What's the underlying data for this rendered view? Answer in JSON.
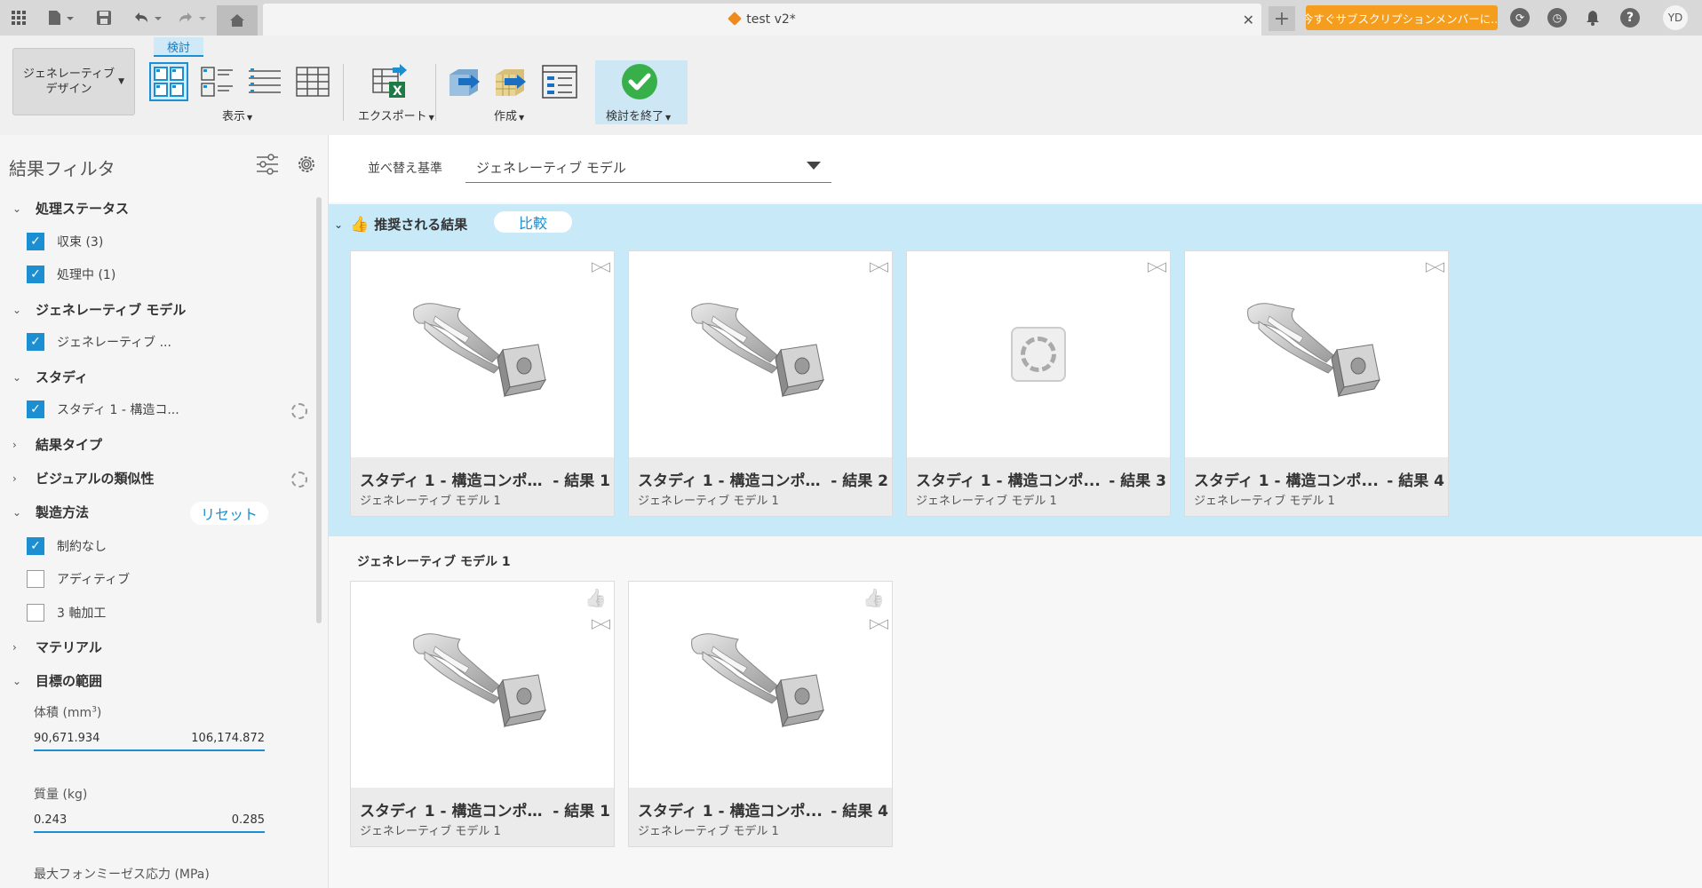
{
  "titlebar": {
    "doc_title": "test v2*",
    "subscribe_label": "今すぐサブスクリプションメンバーに...",
    "user_initials": "YD"
  },
  "ribbon": {
    "generative_design_label": "ジェネレーティブ\nデザイン",
    "active_tab": "検討",
    "display_label": "表示",
    "export_label": "エクスポート",
    "create_label": "作成",
    "finish_label": "検討を終了"
  },
  "left_panel": {
    "title": "結果フィルタ",
    "sections": {
      "status": "処理ステータス",
      "status_converged": "収束 (3)",
      "status_processing": "処理中 (1)",
      "model": "ジェネレーティブ モデル",
      "model_item": "ジェネレーティブ ...",
      "study": "スタディ",
      "study_item": "スタディ 1 - 構造コ...",
      "result_type": "結果タイプ",
      "visual_similarity": "ビジュアルの類似性",
      "manufacturing": "製造方法",
      "reset": "リセット",
      "unrestricted": "制約なし",
      "additive": "アディティブ",
      "three_axis": "3 軸加工",
      "material": "マテリアル",
      "target_range": "目標の範囲"
    },
    "volume": {
      "label": "体積 (mm",
      "sup": "3",
      "close": ")",
      "min": "90,671.934",
      "max": "106,174.872"
    },
    "mass": {
      "label": "質量 (kg)",
      "min": "0.243",
      "max": "0.285"
    },
    "stress_label": "最大フォンミーゼス応力 (MPa)"
  },
  "sort": {
    "label": "並べ替え基準",
    "value": "ジェネレーティブ モデル"
  },
  "recommended": {
    "title": "推奨される結果",
    "compare": "比較",
    "cards": [
      {
        "name": "スタディ 1 - 構造コンポー...",
        "result": "- 結果 1",
        "model": "ジェネレーティブ モデル 1"
      },
      {
        "name": "スタディ 1 - 構造コンポー...",
        "result": "- 結果 2",
        "model": "ジェネレーティブ モデル 1"
      },
      {
        "name": "スタディ 1 - 構造コンポ...",
        "result": "- 結果 3",
        "model": "ジェネレーティブ モデル 1"
      },
      {
        "name": "スタディ 1 - 構造コンポ...",
        "result": "- 結果 4",
        "model": "ジェネレーティブ モデル 1"
      }
    ]
  },
  "group": {
    "title": "ジェネレーティブ モデル 1",
    "cards": [
      {
        "name": "スタディ 1 - 構造コンポー...",
        "result": "- 結果 1",
        "model": "ジェネレーティブ モデル 1"
      },
      {
        "name": "スタディ 1 - 構造コンポ...",
        "result": "- 結果 4",
        "model": "ジェネレーティブ モデル 1"
      }
    ]
  }
}
